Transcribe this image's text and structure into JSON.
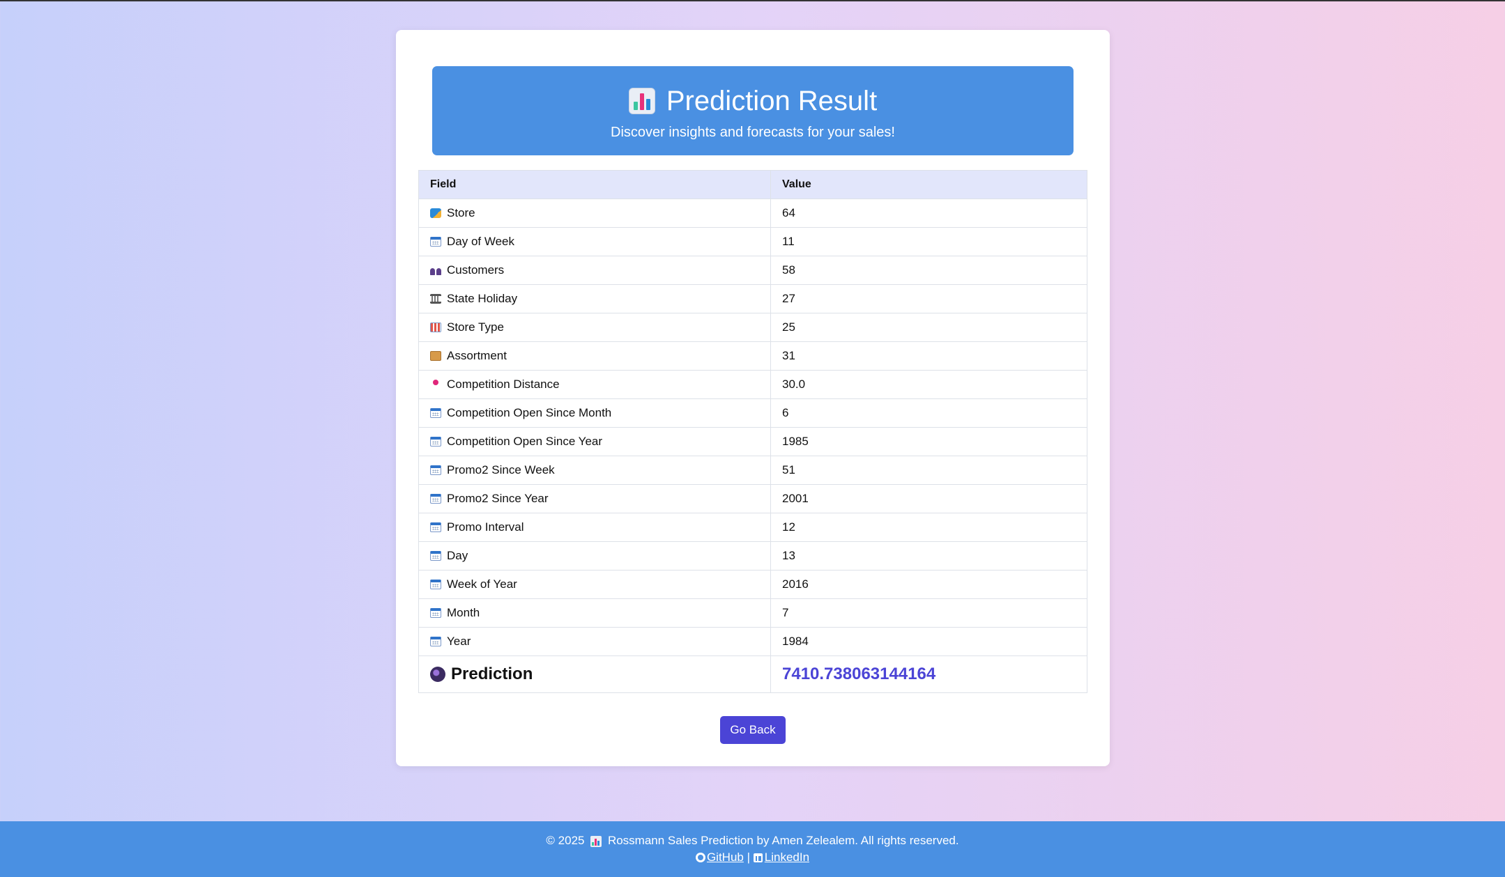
{
  "header": {
    "title": "Prediction Result",
    "subtitle": "Discover insights and forecasts for your sales!",
    "icon": "bar-chart-icon"
  },
  "table": {
    "columns": [
      "Field",
      "Value"
    ],
    "rows": [
      {
        "icon": "shopping-bags-icon",
        "field": "Store",
        "value": "64"
      },
      {
        "icon": "calendar-icon",
        "field": "Day of Week",
        "value": "11"
      },
      {
        "icon": "people-icon",
        "field": "Customers",
        "value": "58"
      },
      {
        "icon": "bank-icon",
        "field": "State Holiday",
        "value": "27"
      },
      {
        "icon": "store-icon",
        "field": "Store Type",
        "value": "25"
      },
      {
        "icon": "package-icon",
        "field": "Assortment",
        "value": "31"
      },
      {
        "icon": "pin-icon",
        "field": "Competition Distance",
        "value": "30.0"
      },
      {
        "icon": "calendar-icon",
        "field": "Competition Open Since Month",
        "value": "6"
      },
      {
        "icon": "calendar-icon",
        "field": "Competition Open Since Year",
        "value": "1985"
      },
      {
        "icon": "calendar-icon",
        "field": "Promo2 Since Week",
        "value": "51"
      },
      {
        "icon": "calendar-icon",
        "field": "Promo2 Since Year",
        "value": "2001"
      },
      {
        "icon": "calendar-icon",
        "field": "Promo Interval",
        "value": "12"
      },
      {
        "icon": "calendar-icon",
        "field": "Day",
        "value": "13"
      },
      {
        "icon": "calendar-icon",
        "field": "Week of Year",
        "value": "2016"
      },
      {
        "icon": "calendar-icon",
        "field": "Month",
        "value": "7"
      },
      {
        "icon": "calendar-icon",
        "field": "Year",
        "value": "1984"
      }
    ],
    "prediction": {
      "icon": "crystal-ball-icon",
      "label": "Prediction",
      "value": "7410.738063144164"
    }
  },
  "actions": {
    "go_back_label": "Go Back"
  },
  "footer": {
    "prefix": "© 2025",
    "text": "Rossmann Sales Prediction by Amen Zelealem. All rights reserved.",
    "github_label": "GitHub",
    "separator": "|",
    "linkedin_label": "LinkedIn"
  },
  "colors": {
    "accent": "#4a90e2",
    "button": "#4b44d6",
    "prediction_value": "#4b44d6"
  }
}
